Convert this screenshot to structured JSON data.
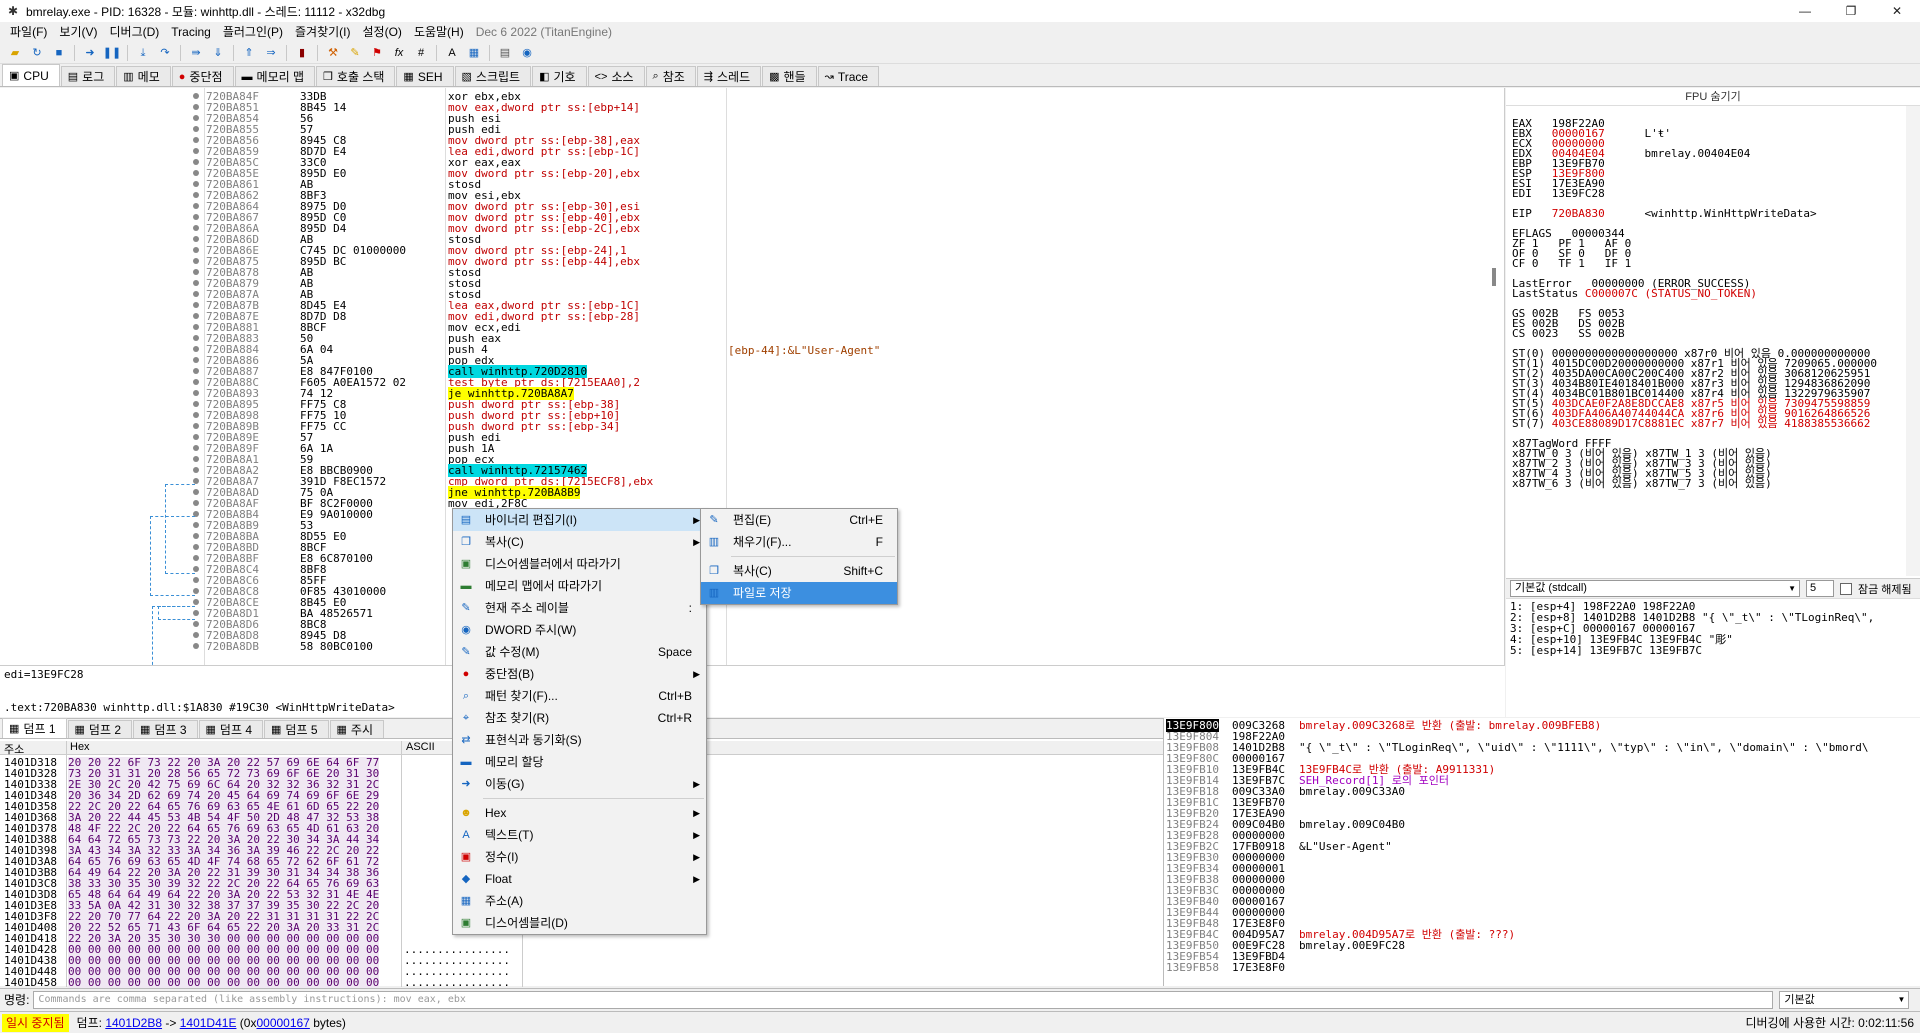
{
  "window": {
    "title": "bmrelay.exe - PID: 16328 - 모듈: winhttp.dll - 스레드: 11112 - x32dbg",
    "minimize": "—",
    "maximize": "❐",
    "close": "✕"
  },
  "menubar": {
    "items": [
      "파일(F)",
      "보기(V)",
      "디버그(D)",
      "Tracing",
      "플러그인(P)",
      "즐겨찾기(I)",
      "설정(O)",
      "도움말(H)"
    ],
    "info": "Dec 6 2022 (TitanEngine)"
  },
  "tabs": [
    {
      "label": "CPU",
      "icon": "cpu-icon",
      "glyph": "▣"
    },
    {
      "label": "로그",
      "icon": "log-icon",
      "glyph": "▤"
    },
    {
      "label": "메모",
      "icon": "notes-icon",
      "glyph": "▥"
    },
    {
      "label": "중단점",
      "icon": "breakpoint-icon",
      "glyph": "●"
    },
    {
      "label": "메모리 맵",
      "icon": "memory-map-icon",
      "glyph": "▬"
    },
    {
      "label": "호출 스택",
      "icon": "call-stack-icon",
      "glyph": "❒"
    },
    {
      "label": "SEH",
      "icon": "seh-icon",
      "glyph": "▦"
    },
    {
      "label": "스크립트",
      "icon": "script-icon",
      "glyph": "▧"
    },
    {
      "label": "기호",
      "icon": "symbols-icon",
      "glyph": "◧"
    },
    {
      "label": "소스",
      "icon": "source-icon",
      "glyph": "<>"
    },
    {
      "label": "참조",
      "icon": "references-icon",
      "glyph": "⌕"
    },
    {
      "label": "스레드",
      "icon": "threads-icon",
      "glyph": "⇶"
    },
    {
      "label": "핸들",
      "icon": "handles-icon",
      "glyph": "▩"
    },
    {
      "label": "Trace",
      "icon": "trace-icon",
      "glyph": "↝"
    }
  ],
  "disasm": {
    "addresses": "720BA84F\n720BA851\n720BA854\n720BA855\n720BA856\n720BA859\n720BA85C\n720BA85E\n720BA861\n720BA862\n720BA864\n720BA867\n720BA86A\n720BA86D\n720BA86E\n720BA875\n720BA878\n720BA879\n720BA87A\n720BA87B\n720BA87E\n720BA881\n720BA883\n720BA884\n720BA886\n720BA887\n720BA88C\n720BA893\n720BA895\n720BA898\n720BA89B\n720BA89E\n720BA89F\n720BA8A1\n720BA8A2\n720BA8A7\n720BA8AD\n720BA8AF\n720BA8B4\n720BA8B9\n720BA8BA\n720BA8BD\n720BA8BF\n720BA8C4\n720BA8C6\n720BA8C8\n720BA8CE\n720BA8D1\n720BA8D6\n720BA8D8\n720BA8DB",
    "bytes": "33DB\n8B45 14\n56\n57\n8945 C8\n8D7D E4\n33C0\n895D E0\nAB\n8BF3\n8975 D0\n895D C0\n895D D4\nAB\nC745 DC 01000000\n895D BC\nAB\nAB\nAB\n8D45 E4\n8D7D D8\n8BCF\n50\n6A 04\n5A\nE8 847F0100\nF605 A0EA1572 02\n74 12\nFF75 C8\nFF75 10\nFF75 CC\n57\n6A 1A\n59\nE8 BBCB0900\n391D F8EC1572\n75 0A\nBF 8C2F0000\nE9 9A010000\n53\n8D55 E0\n8BCF\nE8 6C870100\n8BF8\n85FF\n0F85 43010000\n8B45 E0\nBA 48526571\n8BC8\n8945 D8\n58 80BC0100",
    "asm": [
      "xor ebx,ebx",
      "mov eax,dword ptr ss:[ebp+14]",
      "push esi",
      "push edi",
      "mov dword ptr ss:[ebp-38],eax",
      "lea edi,dword ptr ss:[ebp-1C]",
      "xor eax,eax",
      "mov dword ptr ss:[ebp-20],ebx",
      "stosd",
      "mov esi,ebx",
      "mov dword ptr ss:[ebp-30],esi",
      "mov dword ptr ss:[ebp-40],ebx",
      "mov dword ptr ss:[ebp-2C],ebx",
      "stosd",
      "mov dword ptr ss:[ebp-24],1",
      "mov dword ptr ss:[ebp-44],ebx",
      "stosd",
      "stosd",
      "stosd",
      "lea eax,dword ptr ss:[ebp-1C]",
      "mov edi,dword ptr ss:[ebp-28]",
      "mov ecx,edi",
      "push eax",
      "push 4",
      "pop edx",
      "call winhttp.720D2810",
      "test byte ptr ds:[7215EAA0],2",
      "je winhttp.720BA8A7",
      "push dword ptr ss:[ebp-38]",
      "push dword ptr ss:[ebp+10]",
      "push dword ptr ss:[ebp-34]",
      "push edi",
      "push 1A",
      "pop ecx",
      "call winhttp.72157462",
      "cmp dword ptr ds:[7215ECF8],ebx",
      "jne winhttp.720BA8B9",
      "mov edi,2F8C"
    ],
    "comment": "[ebp-44]:&L\"User-Agent\""
  },
  "info_lines": {
    "line1": "edi=13E9FC28",
    "line2": ".text:720BA830 winhttp.dll:$1A830 #19C30 <WinHttpWriteData>"
  },
  "registers": {
    "header": "FPU 숨기기",
    "text": [
      {
        "t": "EAX   198F22A0"
      },
      {
        "t": "EBX   ",
        "r": "00000167",
        "t2": "      L'ŧ'"
      },
      {
        "t": "ECX   ",
        "r": "00000000"
      },
      {
        "t": "EDX   ",
        "r": "00404E04",
        "t2": "      bmrelay.00404E04"
      },
      {
        "t": "EBP   13E9FB70"
      },
      {
        "t": "ESP   ",
        "r": "13E9F800"
      },
      {
        "t": "ESI   17E3EA90"
      },
      {
        "t": "EDI   13E9FC28"
      },
      {
        "t": ""
      },
      {
        "t": "EIP   ",
        "r": "720BA830",
        "t2": "      <winhttp.WinHttpWriteData>"
      },
      {
        "t": ""
      },
      {
        "t": "EFLAGS   00000344"
      },
      {
        "t": "ZF 1   PF 1   AF 0"
      },
      {
        "t": "OF 0   SF 0   DF 0"
      },
      {
        "t": "CF 0   TF 1   IF 1"
      },
      {
        "t": ""
      },
      {
        "t": "LastError   00000000 (ERROR_SUCCESS)"
      },
      {
        "t": "LastStatus ",
        "r": "C000007C (STATUS_NO_TOKEN)"
      },
      {
        "t": ""
      },
      {
        "t": "GS 002B   FS 0053"
      },
      {
        "t": "ES 002B   DS 002B"
      },
      {
        "t": "CS 0023   SS 002B"
      },
      {
        "t": ""
      },
      {
        "t": "ST(0) 0000000000000000000 x87r0 비어 있음 0.000000000000"
      },
      {
        "t": "ST(1) 4015DC00D20000000000 x87r1 비어 있음 7209065.000000"
      },
      {
        "t": "ST(2) 4035DA00CA00C200C400 x87r2 비어 있음 3068120625951"
      },
      {
        "t": "ST(3) 4034B80IE4018401B000 x87r3 비어 있음 1294836862090"
      },
      {
        "t": "ST(4) 4034BC01B801BC014400 x87r4 비어 있음 1322979635907"
      },
      {
        "t": "ST(5) ",
        "r": "403DCAE0F2A8E8DCCAE8 x87r5 비어 있음 7309475598859"
      },
      {
        "t": "ST(6) ",
        "r": "403DFA406A40744044CA x87r6 비어 있음 9016264866526"
      },
      {
        "t": "ST(7) ",
        "r": "403CE88089D17C8881EC x87r7 비어 있음 4188385536662"
      },
      {
        "t": ""
      },
      {
        "t": "x87TagWord FFFF"
      },
      {
        "t": "x87TW_0 3 (비어 있음) x87TW_1 3 (비어 있음)"
      },
      {
        "t": "x87TW_2 3 (비어 있음) x87TW_3 3 (비어 있음)"
      },
      {
        "t": "x87TW_4 3 (비어 있음) x87TW_5 3 (비어 있음)"
      },
      {
        "t": "x87TW_6 3 (비어 있음) x87TW_7 3 (비어 있음)"
      }
    ]
  },
  "callargs": {
    "convention": "기본값 (stdcall)",
    "count": "5",
    "lock_label": "잠금 해제됨",
    "lines": "1: [esp+4] 198F22A0 198F22A0\n2: [esp+8] 1401D2B8 1401D2B8 \"{ \\\"_t\\\" : \\\"TLoginReq\\\",\n3: [esp+C] 00000167 00000167\n4: [esp+10] 13E9FB4C 13E9FB4C \"彫\"\n5: [esp+14] 13E9FB7C 13E9FB7C"
  },
  "dump": {
    "tabs": [
      "덤프 1",
      "덤프 2",
      "덤프 3",
      "덤프 4",
      "덤프 5",
      "주시"
    ],
    "col_addr": "주소",
    "col_hex": "Hex",
    "col_ascii": "ASCII",
    "addresses": "1401D318\n1401D328\n1401D338\n1401D348\n1401D358\n1401D368\n1401D378\n1401D388\n1401D398\n1401D3A8\n1401D3B8\n1401D3C8\n1401D3D8\n1401D3E8\n1401D3F8\n1401D408\n1401D418\n1401D428\n1401D438\n1401D448\n1401D458",
    "hex": "20 20 22 6F 73 22 20 3A 20 22 57 69 6E 64 6F 77\n73 20 31 31 20 28 56 65 72 73 69 6F 6E 20 31 30\n2E 30 2C 20 42 75 69 6C 64 20 32 32 36 32 31 2C\n20 36 34 2D 62 69 74 20 45 64 69 74 69 6F 6E 29\n22 2C 20 22 64 65 76 69 63 65 4E 61 6D 65 22 20\n3A 20 22 44 45 53 4B 54 4F 50 2D 48 47 32 53 38\n48 4F 22 2C 20 22 64 65 76 69 63 65 4D 61 63 20\n64 64 72 65 73 73 22 20 3A 20 22 30 34 3A 44 34\n3A 43 34 3A 32 33 3A 34 36 3A 39 46 22 2C 20 22\n64 65 76 69 63 65 4D 4F 74 68 65 72 62 6F 61 72\n64 49 64 22 20 3A 20 22 31 39 30 31 34 34 38 36\n38 33 30 35 30 39 32 22 2C 20 22 64 65 76 69 63\n65 48 64 64 49 64 22 20 3A 20 22 53 32 31 4E 4E\n33 5A 0A 42 31 30 32 38 37 37 39 35 30 22 2C 20\n22 20 70 77 64 22 20 3A 20 22 31 31 31 31 22 2C\n20 22 52 65 71 43 6F 64 65 22 20 3A 20 33 31 2C\n22 20 3A 20 35 30 30 30 00 00 00 00 00 00 00 00\n00 00 00 00 00 00 00 00 00 00 00 00 00 00 00 00\n00 00 00 00 00 00 00 00 00 00 00 00 00 00 00 00\n00 00 00 00 00 00 00 00 00 00 00 00 00 00 00 00\n00 00 00 00 00 00 00 00 00 00 00 00 00 00 00 00",
    "ascii": "\n\n\n\n\n\n\n\n\n\n\n\n\n\n\n\n\n................\n................\n................\n................"
  },
  "stack": {
    "current": "13E9F800",
    "addresses": "13E9F804\n13E9FB08\n13E9F80C\n13E9FB10\n13E9FB14\n13E9FB18\n13E9FB1C\n13E9FB20\n13E9FB24\n13E9FB28\n13E9FB2C\n13E9FB30\n13E9FB34\n13E9FB38\n13E9FB3C\n13E9FB40\n13E9FB44\n13E9FB48\n13E9FB4C\n13E9FB50\n13E9FB54\n13E9FB58",
    "values": "009C3268\n198F22A0\n1401D2B8\n00000167\n13E9FB4C\n13E9FB7C\n009C33A0\n13E9FB70\n17E3EA90\n009C04B0\n00000000\n17FB0918\n00000000\n00000001\n00000000\n00000000\n00000167\n00000000\n17E3E8F0\n004D95A7\n00E9FC28\n13E9FBD4\n17E3E8F0",
    "comments": [
      {
        "c": "red",
        "t": "bmrelay.009C3268로 반환 (출발: bmrelay.009BFEB8)"
      },
      {
        "c": "",
        "t": ""
      },
      {
        "c": "",
        "t": "\"{ \\\"_t\\\" : \\\"TLoginReq\\\", \\\"uid\\\" : \\\"1111\\\", \\\"typ\\\" : \\\"in\\\", \\\"domain\\\" : \\\"bmord\\"
      },
      {
        "c": "",
        "t": ""
      },
      {
        "c": "red",
        "t": "13E9FB4C로 반환 (출발: A9911331)"
      },
      {
        "c": "purple",
        "t": "SEH_Record[1] 로의 포인터"
      },
      {
        "c": "",
        "t": "bmrelay.009C33A0"
      },
      {
        "c": "",
        "t": ""
      },
      {
        "c": "",
        "t": ""
      },
      {
        "c": "",
        "t": "bmrelay.009C04B0"
      },
      {
        "c": "",
        "t": ""
      },
      {
        "c": "",
        "t": "&L\"User-Agent\""
      },
      {
        "c": "",
        "t": ""
      },
      {
        "c": "",
        "t": ""
      },
      {
        "c": "",
        "t": ""
      },
      {
        "c": "",
        "t": ""
      },
      {
        "c": "",
        "t": ""
      },
      {
        "c": "",
        "t": ""
      },
      {
        "c": "",
        "t": ""
      },
      {
        "c": "red",
        "t": "bmrelay.004D95A7로 반환 (출발: ???)"
      },
      {
        "c": "",
        "t": "bmrelay.00E9FC28"
      }
    ]
  },
  "context_menu": [
    {
      "label": "바이너리 편집기(I)",
      "icon": "binary-edit-icon",
      "submenu": true,
      "selected": false,
      "hot": true
    },
    {
      "label": "복사(C)",
      "icon": "copy-icon",
      "submenu": true
    },
    {
      "label": "디스어셈블러에서 따라가기",
      "icon": "follow-disasm-icon"
    },
    {
      "label": "메모리 맵에서 따라가기",
      "icon": "follow-memmap-icon"
    },
    {
      "label": "현재 주소 레이블",
      "icon": "label-icon",
      "shortcut": ":"
    },
    {
      "label": "DWORD 주시(W)",
      "icon": "watch-icon"
    },
    {
      "label": "값 수정(M)",
      "icon": "modify-value-icon",
      "shortcut": "Space"
    },
    {
      "label": "중단점(B)",
      "icon": "breakpoint-icon",
      "submenu": true
    },
    {
      "label": "패턴 찾기(F)...",
      "icon": "find-pattern-icon",
      "shortcut": "Ctrl+B"
    },
    {
      "label": "참조 찾기(R)",
      "icon": "find-refs-icon",
      "shortcut": "Ctrl+R"
    },
    {
      "label": "표현식과 동기화(S)",
      "icon": "sync-icon"
    },
    {
      "label": "메모리 할당",
      "icon": "alloc-icon"
    },
    {
      "label": "이동(G)",
      "icon": "goto-icon",
      "submenu": true
    },
    {
      "sep": true
    },
    {
      "label": "Hex",
      "icon": "hex-icon",
      "submenu": true
    },
    {
      "label": "텍스트(T)",
      "icon": "text-icon",
      "submenu": true
    },
    {
      "label": "정수(I)",
      "icon": "integer-icon",
      "submenu": true
    },
    {
      "label": "Float",
      "icon": "float-icon",
      "submenu": true
    },
    {
      "label": "주소(A)",
      "icon": "address-icon"
    },
    {
      "label": "디스어셈블리(D)",
      "icon": "disassembly-icon"
    }
  ],
  "submenu": [
    {
      "label": "편집(E)",
      "icon": "edit-icon",
      "shortcut": "Ctrl+E"
    },
    {
      "label": "채우기(F)...",
      "icon": "fill-icon",
      "shortcut": "F"
    },
    {
      "sep": true
    },
    {
      "label": "복사(C)",
      "icon": "copy-icon",
      "shortcut": "Shift+C"
    },
    {
      "label": "파일로 저장",
      "icon": "save-to-file-icon",
      "selected": true
    }
  ],
  "cmdbar": {
    "label": "명령:",
    "placeholder": "Commands are comma separated (like assembly instructions): mov eax, ebx",
    "mode": "기본값"
  },
  "statusbar": {
    "state": "일시 중지됨",
    "dump_label": "덤프:",
    "from": "1401D2B8",
    "arrow": "->",
    "to": "1401D41E",
    "size_prefix": "(0x",
    "size": "00000167",
    "size_suffix": " bytes)",
    "time": "디버깅에 사용한 시간: 0:02:11:56"
  },
  "colors": {
    "call_highlight": "#00d8e0",
    "jump_highlight": "#ffff00",
    "menu_selected": "#3c8fe0",
    "paused_bg": "#ffff00",
    "paused_fg": "#d00000"
  }
}
